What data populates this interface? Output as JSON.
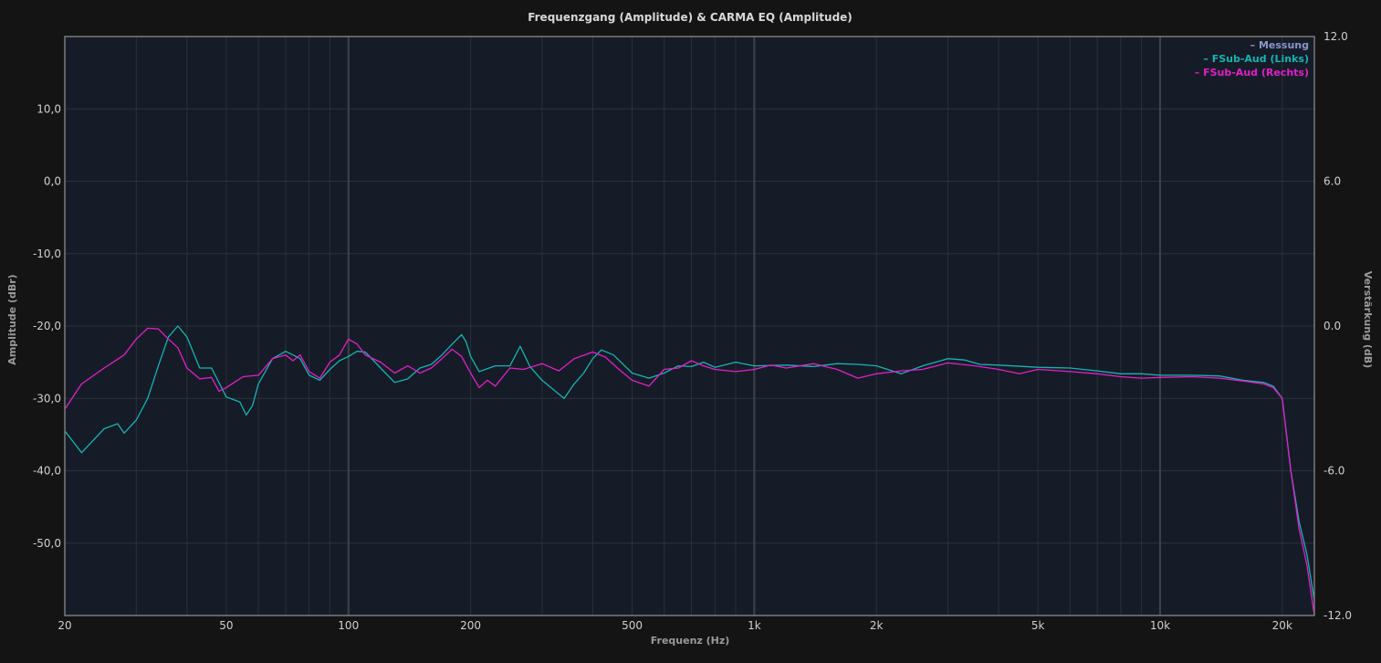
{
  "chart_data": {
    "type": "line",
    "title": "Frequenzgang (Amplitude) & CARMA EQ (Amplitude)",
    "xlabel": "Frequenz (Hz)",
    "ylabel": "Amplitude (dBr)",
    "y2label": "Verstärkung (dB)",
    "xscale": "log",
    "xlim": [
      20,
      24000
    ],
    "ylim": [
      -60,
      20
    ],
    "y2lim": [
      -12,
      12
    ],
    "grid": true,
    "legend_position": "top-right",
    "x_ticks": [
      {
        "value": 20,
        "label": "20"
      },
      {
        "value": 50,
        "label": "50"
      },
      {
        "value": 100,
        "label": "100"
      },
      {
        "value": 200,
        "label": "200"
      },
      {
        "value": 500,
        "label": "500"
      },
      {
        "value": 1000,
        "label": "1k"
      },
      {
        "value": 2000,
        "label": "2k"
      },
      {
        "value": 5000,
        "label": "5k"
      },
      {
        "value": 10000,
        "label": "10k"
      },
      {
        "value": 20000,
        "label": "20k"
      }
    ],
    "y_ticks": [
      {
        "value": 10,
        "label": "10,0"
      },
      {
        "value": 0,
        "label": "0,0"
      },
      {
        "value": -10,
        "label": "-10,0"
      },
      {
        "value": -20,
        "label": "-20,0"
      },
      {
        "value": -30,
        "label": "-30,0"
      },
      {
        "value": -40,
        "label": "-40,0"
      },
      {
        "value": -50,
        "label": "-50,0"
      }
    ],
    "y2_ticks": [
      {
        "value": 12,
        "label": "12.0"
      },
      {
        "value": 6,
        "label": "6.0"
      },
      {
        "value": 0,
        "label": "0.0"
      },
      {
        "value": -6,
        "label": "-6.0"
      },
      {
        "value": -12,
        "label": "-12.0"
      }
    ],
    "series": [
      {
        "name": "Messung",
        "legend_label": "– Messung",
        "color": "#8a96c8",
        "x": [],
        "y": []
      },
      {
        "name": "FSub-Aud (Links)",
        "legend_label": "– FSub-Aud (Links)",
        "color": "#17b3b3",
        "x": [
          20,
          22,
          25,
          27,
          28,
          30,
          32,
          34,
          36,
          38,
          40,
          43,
          46,
          50,
          54,
          56,
          58,
          60,
          65,
          70,
          73,
          76,
          80,
          85,
          90,
          95,
          100,
          105,
          110,
          120,
          130,
          140,
          150,
          160,
          170,
          180,
          190,
          195,
          200,
          210,
          230,
          250,
          265,
          280,
          300,
          320,
          340,
          360,
          380,
          400,
          420,
          450,
          500,
          550,
          600,
          650,
          700,
          750,
          800,
          900,
          1000,
          1200,
          1400,
          1600,
          1800,
          2000,
          2300,
          2600,
          3000,
          3300,
          3600,
          4000,
          5000,
          6000,
          7000,
          8000,
          9000,
          10000,
          12000,
          14000,
          16000,
          18000,
          19000,
          20000,
          21000,
          22000,
          23000,
          24000
        ],
        "y": [
          -34.5,
          -37.5,
          -34.2,
          -33.5,
          -34.8,
          -33,
          -30,
          -25.5,
          -21.5,
          -20,
          -21.5,
          -25.8,
          -25.8,
          -29.8,
          -30.5,
          -32.3,
          -31,
          -28,
          -24.5,
          -23.5,
          -24,
          -24.5,
          -26.8,
          -27.5,
          -26,
          -24.8,
          -24.2,
          -23.5,
          -23.6,
          -25.8,
          -27.8,
          -27.3,
          -25.8,
          -25.3,
          -24,
          -22.5,
          -21.2,
          -22.2,
          -24.2,
          -26.3,
          -25.5,
          -25.5,
          -22.8,
          -25.6,
          -27.5,
          -28.8,
          -30,
          -28,
          -26.5,
          -24.5,
          -23.3,
          -24,
          -26.5,
          -27.2,
          -26.5,
          -25.5,
          -25.6,
          -25,
          -25.7,
          -25,
          -25.5,
          -25.4,
          -25.6,
          -25.2,
          -25.3,
          -25.5,
          -26.6,
          -25.5,
          -24.5,
          -24.7,
          -25.3,
          -25.4,
          -25.7,
          -25.8,
          -26.2,
          -26.6,
          -26.6,
          -26.8,
          -26.8,
          -26.9,
          -27.5,
          -27.8,
          -28.3,
          -30,
          -40,
          -47,
          -51.5,
          -58
        ]
      },
      {
        "name": "FSub-Aud (Rechts)",
        "legend_label": "– FSub-Aud (Rechts)",
        "color": "#e020c8",
        "x": [
          20,
          22,
          25,
          28,
          30,
          32,
          34,
          36,
          38,
          40,
          43,
          46,
          48,
          50,
          55,
          60,
          65,
          70,
          73,
          76,
          80,
          85,
          90,
          95,
          100,
          105,
          110,
          120,
          130,
          140,
          150,
          160,
          170,
          180,
          190,
          200,
          210,
          220,
          230,
          250,
          270,
          300,
          330,
          360,
          400,
          430,
          460,
          500,
          550,
          600,
          650,
          700,
          750,
          800,
          900,
          1000,
          1100,
          1200,
          1400,
          1600,
          1800,
          2000,
          2300,
          2600,
          3000,
          3500,
          4000,
          4500,
          5000,
          6000,
          7000,
          8000,
          9000,
          10000,
          12000,
          14000,
          16000,
          18000,
          19000,
          20000,
          21000,
          22000,
          23000,
          24000
        ],
        "y": [
          -31.5,
          -28,
          -25.8,
          -24,
          -21.8,
          -20.3,
          -20.4,
          -21.8,
          -23,
          -25.8,
          -27.3,
          -27.1,
          -29,
          -28.5,
          -27,
          -26.8,
          -24.5,
          -24,
          -24.8,
          -24,
          -26.3,
          -27.2,
          -25,
          -24,
          -21.8,
          -22.5,
          -24,
          -25,
          -26.5,
          -25.5,
          -26.5,
          -25.8,
          -24.5,
          -23.2,
          -24.2,
          -26.5,
          -28.5,
          -27.5,
          -28.3,
          -25.8,
          -26,
          -25.2,
          -26.2,
          -24.5,
          -23.6,
          -24.3,
          -25.8,
          -27.5,
          -28.3,
          -26,
          -25.8,
          -24.8,
          -25.5,
          -26,
          -26.3,
          -26,
          -25.4,
          -25.8,
          -25.2,
          -26,
          -27.2,
          -26.6,
          -26.2,
          -26,
          -25.1,
          -25.5,
          -26,
          -26.6,
          -26,
          -26.3,
          -26.6,
          -27,
          -27.2,
          -27.1,
          -27,
          -27.2,
          -27.6,
          -28,
          -28.5,
          -30,
          -40,
          -48,
          -53,
          -60
        ]
      }
    ]
  }
}
